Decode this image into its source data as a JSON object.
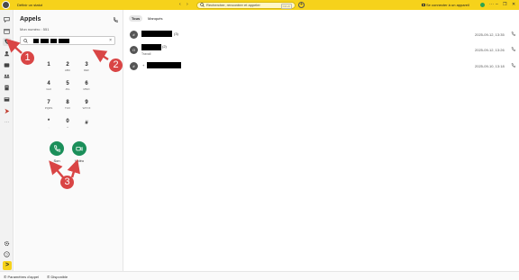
{
  "titlebar": {
    "status_label": "Définir un statut",
    "search_placeholder": "Rechercher, rencontrer et appeler",
    "search_shortcut": "Ctrl+K",
    "connect_label": "Se connecter à un appareil",
    "plus_glyph": "+",
    "back_glyph": "‹",
    "forward_glyph": "›",
    "minimize_glyph": "–",
    "restore_glyph": "❐",
    "close_glyph": "✕",
    "more_glyph": "···"
  },
  "sidebar": {
    "icons": [
      "chat-icon",
      "calendar-icon",
      "phone-icon",
      "contacts-icon",
      "teams-icon",
      "meeting-icon",
      "files-icon",
      "apps-icon",
      "messages-icon",
      "more-icon"
    ],
    "more_glyph": "···",
    "bottom_button": ">"
  },
  "calls_panel": {
    "title": "Appels",
    "my_number_label": "Mon numéro : 551",
    "clear_glyph": "×",
    "keypad": [
      {
        "digit": "1",
        "letters": ""
      },
      {
        "digit": "2",
        "letters": "ABC"
      },
      {
        "digit": "3",
        "letters": "DEF"
      },
      {
        "digit": "4",
        "letters": "GHI"
      },
      {
        "digit": "5",
        "letters": "JKL"
      },
      {
        "digit": "6",
        "letters": "MNO"
      },
      {
        "digit": "7",
        "letters": "PQRS"
      },
      {
        "digit": "8",
        "letters": "TUV"
      },
      {
        "digit": "9",
        "letters": "WXYZ"
      },
      {
        "digit": "*",
        "letters": ","
      },
      {
        "digit": "0",
        "letters": "+"
      },
      {
        "digit": "#",
        "letters": ""
      }
    ],
    "audio_call_label": "Son",
    "video_call_label": "Vidéo"
  },
  "main": {
    "tabs": [
      {
        "label": "Tous",
        "active": true
      },
      {
        "label": "Manqués",
        "active": false
      }
    ],
    "calls": [
      {
        "avatar": "#",
        "count": "(3)",
        "subtitle": "",
        "time": "2025-09-12, 13:35"
      },
      {
        "avatar": "O",
        "count": "(2)",
        "subtitle": "Travail",
        "time": "2025-09-12, 13:26"
      },
      {
        "avatar": "#",
        "count": "+",
        "subtitle": "",
        "time": "2025-09-10, 13:18"
      }
    ]
  },
  "statusbar": {
    "call_settings_label": "Paramètres d'appel",
    "availability_label": "Disponible"
  },
  "annotations": [
    "1",
    "2",
    "3"
  ],
  "colors": {
    "titlebar_bg": "#f6d21b",
    "call_button_green": "#1b8f5a",
    "annotation_red": "#d94545"
  }
}
